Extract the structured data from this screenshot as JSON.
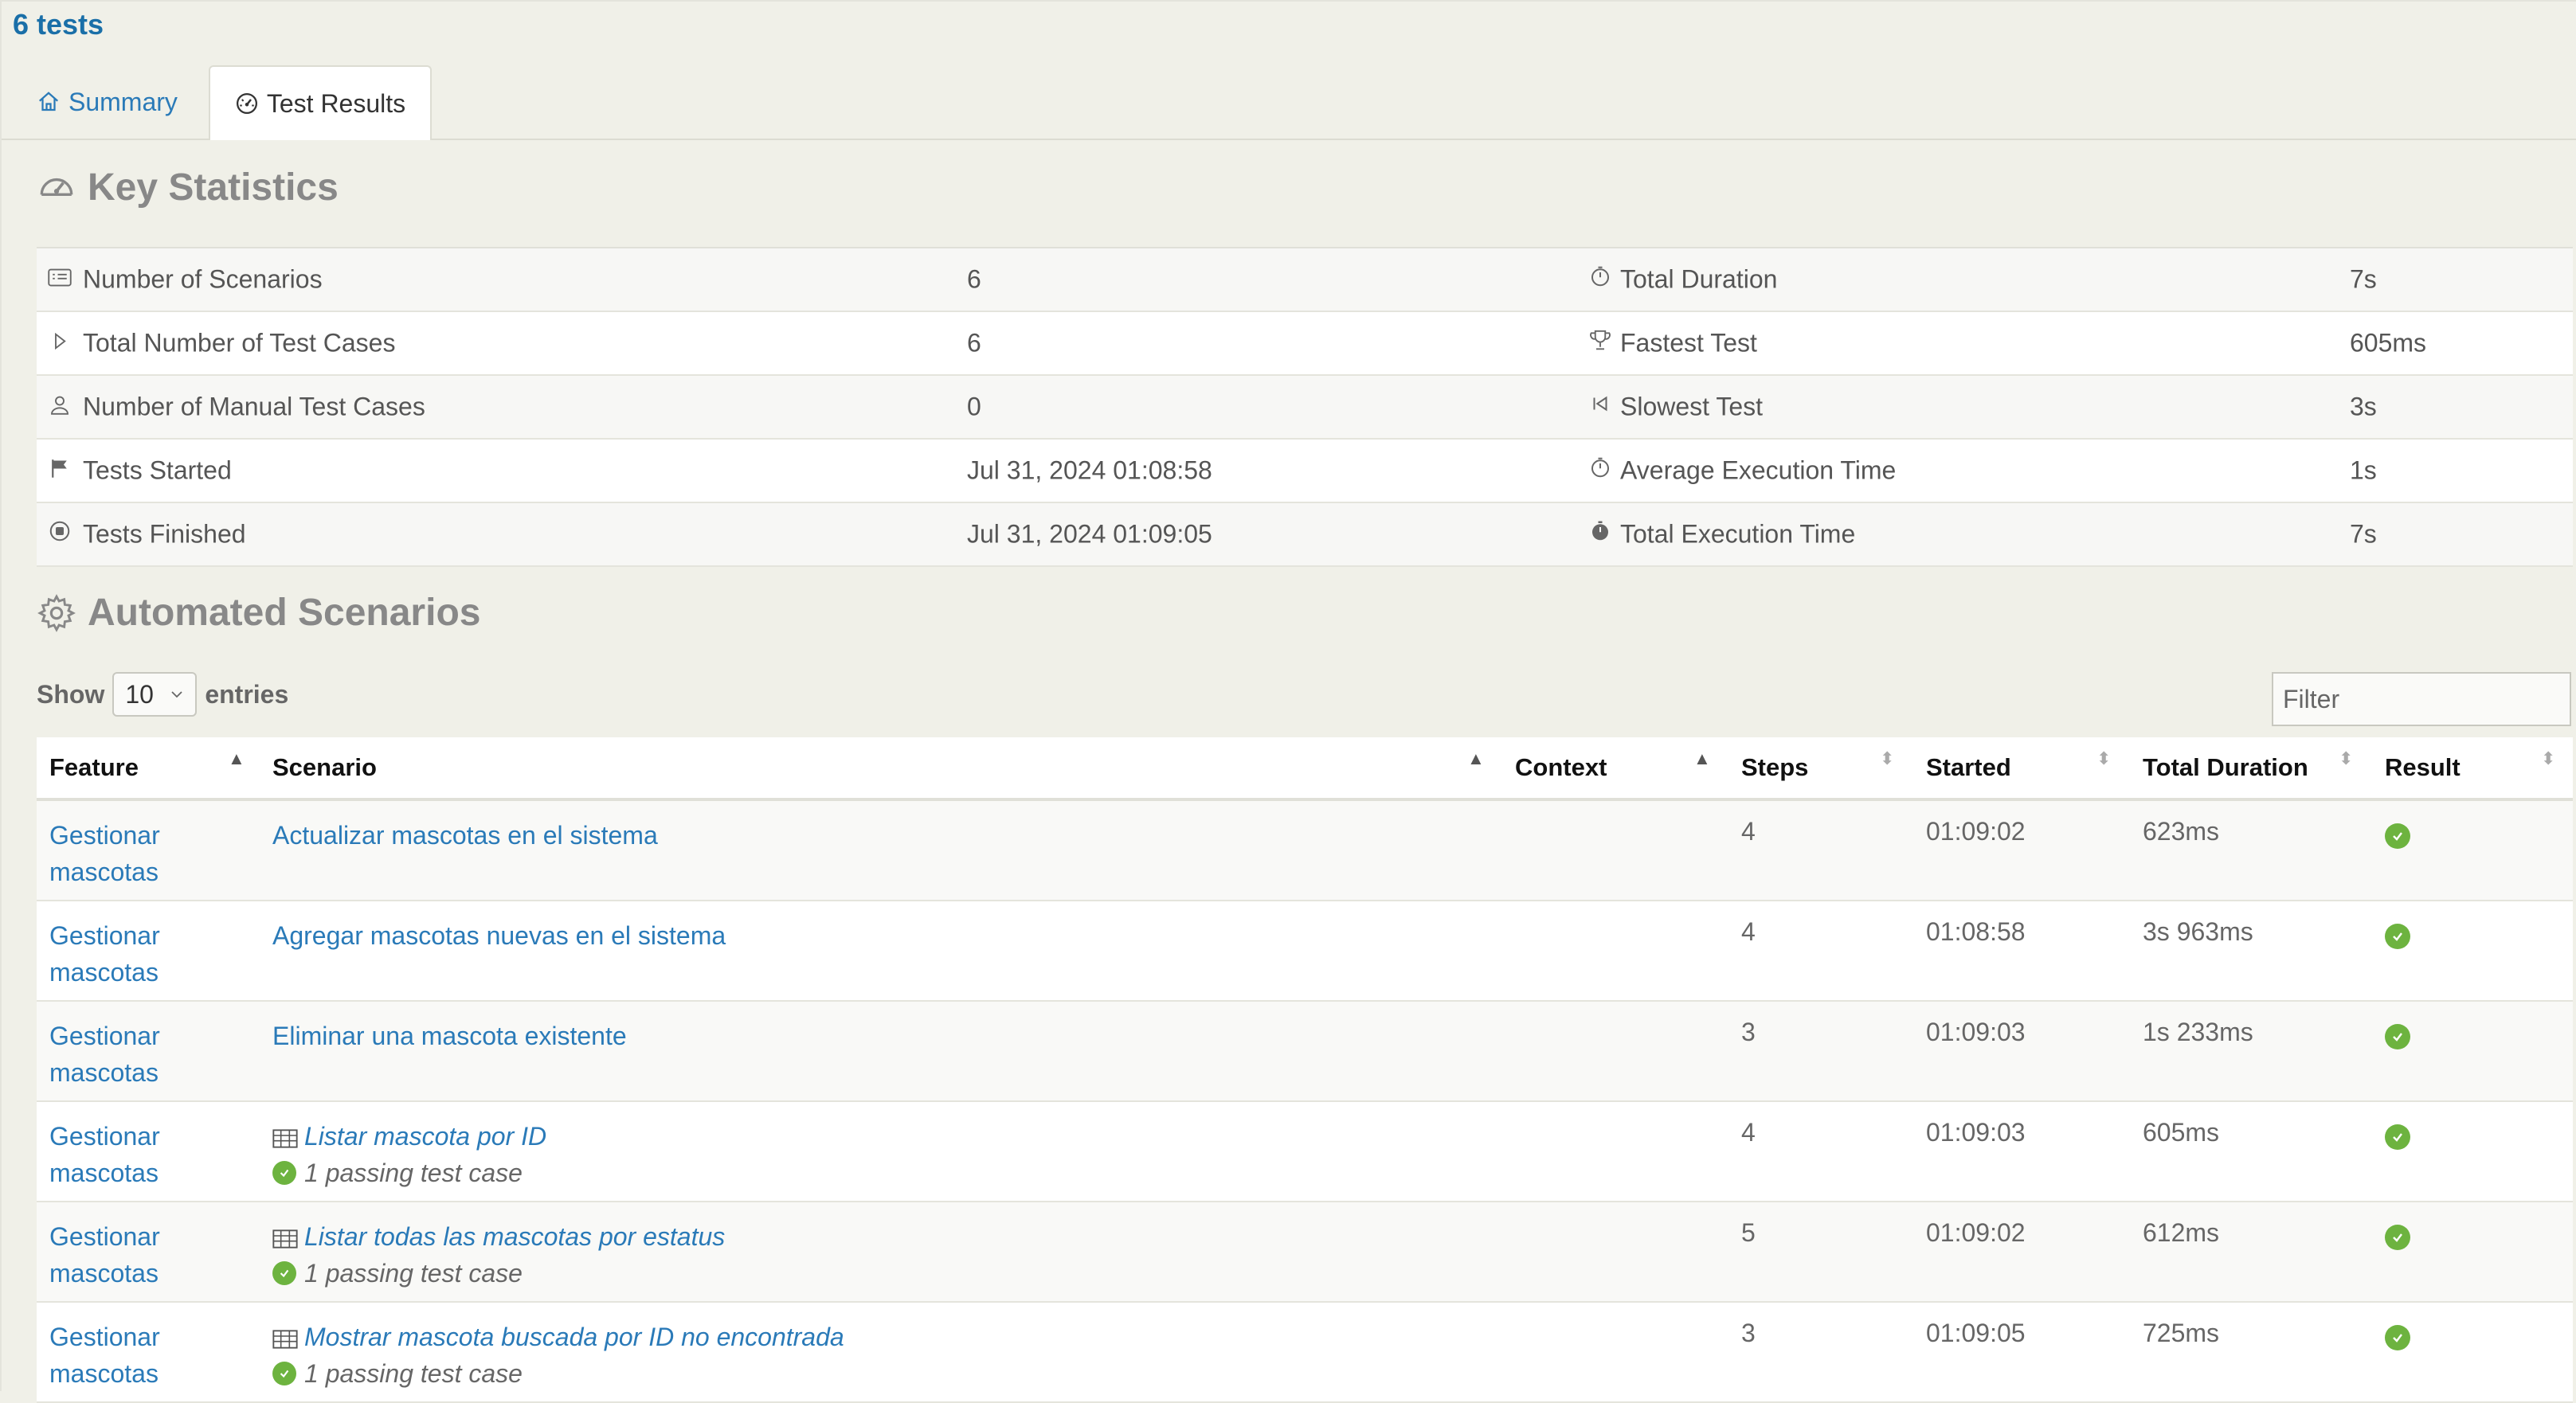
{
  "report_title": "6 tests",
  "tabs": [
    {
      "label": "Summary",
      "icon": "home-icon"
    },
    {
      "label": "Test Results",
      "icon": "dashboard-icon"
    }
  ],
  "key_statistics": {
    "title": "Key Statistics",
    "rows": [
      {
        "label": "Number of Scenarios",
        "value": "6",
        "label2": "Total Duration",
        "value2": "7s"
      },
      {
        "label": "Total Number of Test Cases",
        "value": "6",
        "label2": "Fastest Test",
        "value2": "605ms"
      },
      {
        "label": "Number of Manual Test Cases",
        "value": "0",
        "label2": "Slowest Test",
        "value2": "3s"
      },
      {
        "label": "Tests Started",
        "value": "Jul 31, 2024 01:08:58",
        "label2": "Average Execution Time",
        "value2": "1s"
      },
      {
        "label": "Tests Finished",
        "value": "Jul 31, 2024 01:09:05",
        "label2": "Total Execution Time",
        "value2": "7s"
      }
    ]
  },
  "automated": {
    "title": "Automated Scenarios",
    "show_label": "Show",
    "entries_value": "10",
    "entries_label": "entries",
    "filter_placeholder": "Filter",
    "columns": [
      "Feature",
      "Scenario",
      "Context",
      "Steps",
      "Started",
      "Total Duration",
      "Result"
    ],
    "rows": [
      {
        "feature1": "Gestionar",
        "feature2": "mascotas",
        "scenario": "Actualizar mascotas en el sistema",
        "sub": "",
        "steps": "4",
        "started": "01:09:02",
        "duration": "623ms",
        "result": "passed"
      },
      {
        "feature1": "Gestionar",
        "feature2": "mascotas",
        "scenario": "Agregar mascotas nuevas en el sistema",
        "sub": "",
        "steps": "4",
        "started": "01:08:58",
        "duration": "3s 963ms",
        "result": "passed"
      },
      {
        "feature1": "Gestionar",
        "feature2": "mascotas",
        "scenario": "Eliminar una mascota existente",
        "sub": "",
        "steps": "3",
        "started": "01:09:03",
        "duration": "1s 233ms",
        "result": "passed"
      },
      {
        "feature1": "Gestionar",
        "feature2": "mascotas",
        "scenario": "Listar mascota por ID",
        "sub": "1 passing test case",
        "steps": "4",
        "started": "01:09:03",
        "duration": "605ms",
        "result": "passed"
      },
      {
        "feature1": "Gestionar",
        "feature2": "mascotas",
        "scenario": "Listar todas las mascotas por estatus",
        "sub": "1 passing test case",
        "steps": "5",
        "started": "01:09:02",
        "duration": "612ms",
        "result": "passed"
      },
      {
        "feature1": "Gestionar",
        "feature2": "mascotas",
        "scenario": "Mostrar mascota buscada por ID no encontrada",
        "sub": "1 passing test case",
        "steps": "3",
        "started": "01:09:05",
        "duration": "725ms",
        "result": "passed"
      }
    ]
  },
  "colors": {
    "link": "#2a7ab8",
    "pass": "#6db33f",
    "background": "#f0f0e8"
  }
}
